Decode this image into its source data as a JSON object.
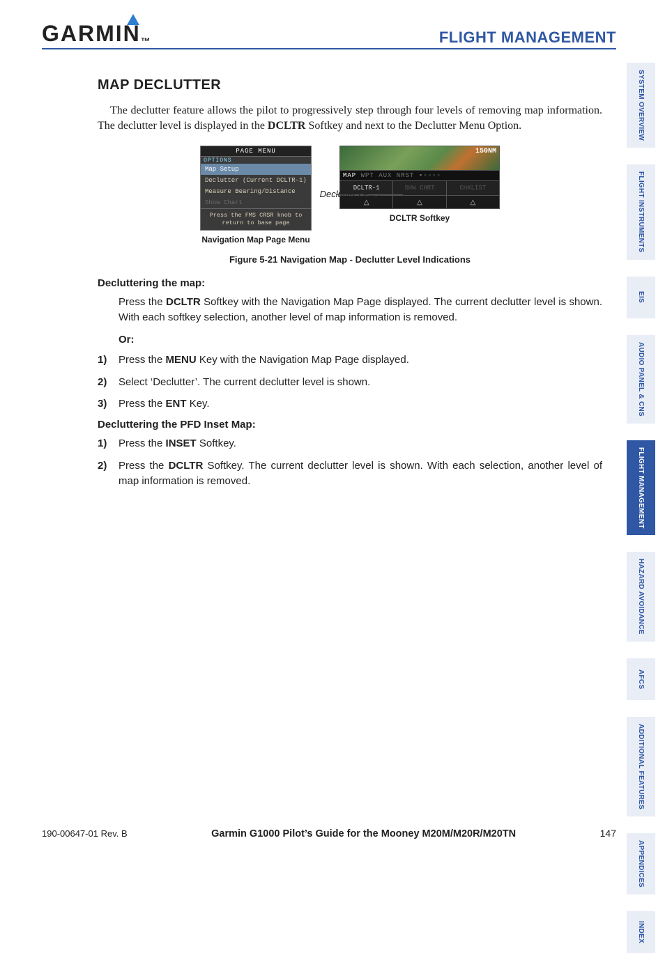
{
  "header": {
    "logo_text": "GARMIN",
    "section": "FLIGHT MANAGEMENT"
  },
  "tabs": [
    {
      "label": "SYSTEM OVERVIEW",
      "active": false
    },
    {
      "label": "FLIGHT INSTRUMENTS",
      "active": false
    },
    {
      "label": "EIS",
      "active": false
    },
    {
      "label": "AUDIO PANEL & CNS",
      "active": false
    },
    {
      "label": "FLIGHT MANAGEMENT",
      "active": true
    },
    {
      "label": "HAZARD AVOIDANCE",
      "active": false
    },
    {
      "label": "AFCS",
      "active": false
    },
    {
      "label": "ADDITIONAL FEATURES",
      "active": false
    },
    {
      "label": "APPENDICES",
      "active": false
    },
    {
      "label": "INDEX",
      "active": false
    }
  ],
  "content": {
    "heading": "MAP DECLUTTER",
    "intro_pre": "The declutter feature allows the pilot to progressively step through four levels of removing map information.  The declutter level is displayed in the ",
    "intro_bold": "DCLTR",
    "intro_post": " Softkey and next to the Declutter Menu Option.",
    "figure": {
      "menu": {
        "title": "PAGE MENU",
        "options_label": "OPTIONS",
        "rows": [
          {
            "text": "Map Setup",
            "hl": true
          },
          {
            "text": "Declutter (Current DCLTR-1)",
            "hl": false
          },
          {
            "text": "Measure Bearing/Distance",
            "hl": false
          },
          {
            "text": "Show Chart",
            "hl": false,
            "dim": true
          }
        ],
        "footer_l1": "Press the FMS CRSR knob to",
        "footer_l2": "return to base page",
        "caption": "Navigation Map Page Menu"
      },
      "softkey": {
        "range": "150NM",
        "strip_on": "MAP",
        "strip_off": " WPT AUX NRST  ▪▫▫▫▫",
        "key_label": "DCLTR-1",
        "key_off1": "SHW CHRT",
        "key_off2": "CHKLIST",
        "caption": "DCLTR Softkey"
      },
      "mid_label": "Declutter Level",
      "caption": "Figure 5-21  Navigation Map - Declutter Level Indications"
    },
    "proc1": {
      "title": "Decluttering the map:",
      "para_pre": "Press the ",
      "para_b1": "DCLTR",
      "para_post": " Softkey with the Navigation Map Page displayed.  The current declutter level is shown.  With each softkey selection, another level of map information is removed.",
      "or": "Or:",
      "steps": [
        {
          "n": "1)",
          "pre": "Press the ",
          "b": "MENU",
          "post": " Key with the Navigation Map Page displayed."
        },
        {
          "n": "2)",
          "pre": "Select ‘Declutter’.  The current declutter level is shown.",
          "b": "",
          "post": ""
        },
        {
          "n": "3)",
          "pre": "Press the ",
          "b": "ENT",
          "post": " Key."
        }
      ]
    },
    "proc2": {
      "title": "Decluttering the PFD Inset Map:",
      "steps": [
        {
          "n": "1)",
          "pre": "Press the ",
          "b": "INSET",
          "post": " Softkey."
        },
        {
          "n": "2)",
          "pre": "Press the ",
          "b": "DCLTR",
          "post": " Softkey.  The current declutter level is shown.  With each selection, another level of map information is removed."
        }
      ]
    }
  },
  "footer": {
    "doc": "190-00647-01  Rev. B",
    "title": "Garmin G1000 Pilot’s Guide for the Mooney M20M/M20R/M20TN",
    "page": "147"
  }
}
